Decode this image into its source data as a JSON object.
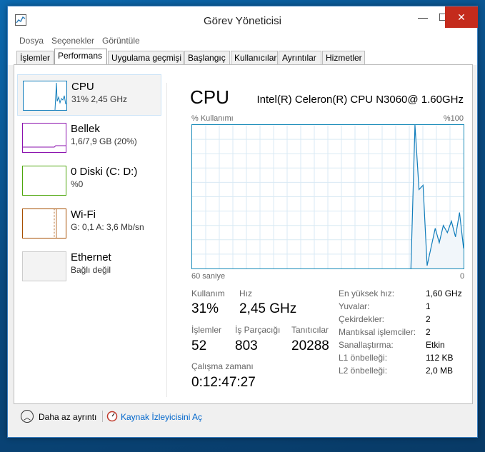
{
  "window": {
    "title": "Görev Yöneticisi"
  },
  "menu": [
    "Dosya",
    "Seçenekler",
    "Görüntüle"
  ],
  "tabs": [
    "İşlemler",
    "Performans",
    "Uygulama geçmişi",
    "Başlangıç",
    "Kullanıcılar",
    "Ayrıntılar",
    "Hizmetler"
  ],
  "active_tab": "Performans",
  "sidebar": {
    "items": [
      {
        "name": "CPU",
        "sub": "31% 2,45 GHz",
        "color": "#117dbb"
      },
      {
        "name": "Bellek",
        "sub": "1,6/7,9 GB (20%)",
        "color": "#8b12ae"
      },
      {
        "name": "0 Diski (C: D:)",
        "sub": "%0",
        "color": "#4da60c"
      },
      {
        "name": "Wi-Fi",
        "sub": "G: 0,1 A: 3,6 Mb/sn",
        "color": "#a74f01"
      },
      {
        "name": "Ethernet",
        "sub": "Bağlı değil",
        "color": "#cccccc"
      }
    ]
  },
  "main": {
    "title": "CPU",
    "model": "Intel(R) Celeron(R) CPU N3060@ 1.60GHz",
    "graph_label": "% Kullanımı",
    "graph_max": "%100",
    "axis_left": "60 saniye",
    "axis_right": "0",
    "graph_percent": [
      0,
      0,
      0,
      0,
      0,
      0,
      0,
      0,
      0,
      0,
      0,
      0,
      0,
      0,
      0,
      0,
      0,
      0,
      0,
      0,
      0,
      0,
      0,
      0,
      0,
      0,
      0,
      0,
      0,
      0,
      0,
      0,
      0,
      0,
      0,
      0,
      0,
      0,
      0,
      0,
      0,
      0,
      0,
      0,
      0,
      0,
      0,
      0,
      0,
      0,
      0,
      0,
      0,
      0,
      0,
      100,
      55,
      58,
      2,
      15,
      28,
      18,
      30,
      25,
      33,
      22,
      39,
      14
    ]
  },
  "stats": {
    "kullanim": {
      "label": "Kullanım",
      "value": "31%"
    },
    "hiz": {
      "label": "Hız",
      "value": "2,45 GHz"
    },
    "islemler": {
      "label": "İşlemler",
      "value": "52"
    },
    "is_parcacigi": {
      "label": "İş Parçacığı",
      "value": "803"
    },
    "tanitici": {
      "label": "Tanıtıcılar",
      "value": "20288"
    },
    "calisma": {
      "label": "Çalışma zamanı",
      "value": "0:12:47:27"
    }
  },
  "specs": [
    {
      "label": "En yüksek hız:",
      "value": "1,60 GHz"
    },
    {
      "label": "Yuvalar:",
      "value": "1"
    },
    {
      "label": "Çekirdekler:",
      "value": "2"
    },
    {
      "label": "Mantıksal işlemciler:",
      "value": "2"
    },
    {
      "label": "Sanallaştırma:",
      "value": "Etkin"
    },
    {
      "label": "L1 önbelleği:",
      "value": "112 KB"
    },
    {
      "label": "L2 önbelleği:",
      "value": "2,0 MB"
    }
  ],
  "footer": {
    "less_details": "Daha az ayrıntı",
    "resource_monitor": "Kaynak İzleyicisini Aç"
  },
  "colors": {
    "cpu_graph": "#117dbb",
    "link": "#0066cc"
  }
}
